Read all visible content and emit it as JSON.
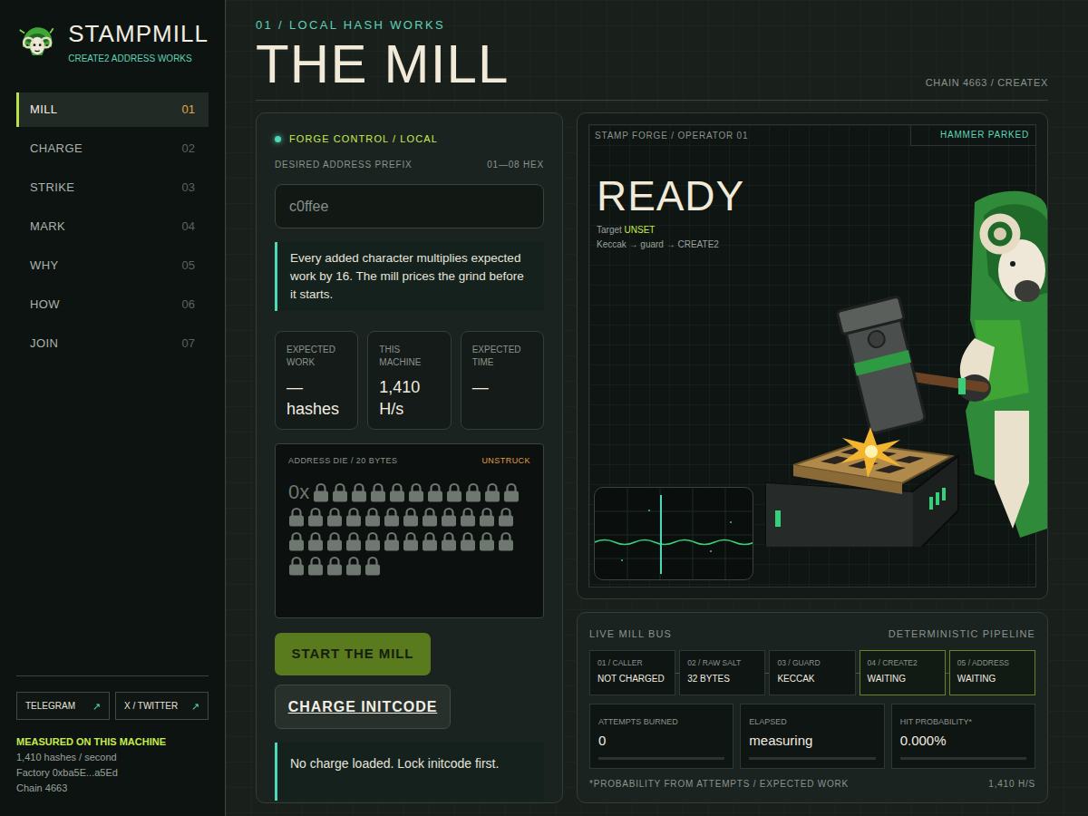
{
  "brand": {
    "name": "STAMPMILL",
    "tagline": "CREATE2 ADDRESS WORKS"
  },
  "nav": [
    {
      "label": "MILL",
      "number": "01",
      "selected": true
    },
    {
      "label": "CHARGE",
      "number": "02",
      "selected": false
    },
    {
      "label": "STRIKE",
      "number": "03",
      "selected": false
    },
    {
      "label": "MARK",
      "number": "04",
      "selected": false
    },
    {
      "label": "WHY",
      "number": "05",
      "selected": false
    },
    {
      "label": "HOW",
      "number": "06",
      "selected": false
    },
    {
      "label": "JOIN",
      "number": "07",
      "selected": false
    }
  ],
  "links": [
    {
      "label": "TELEGRAM",
      "icon": "↗"
    },
    {
      "label": "X / TWITTER",
      "icon": "↗"
    }
  ],
  "machine": {
    "title": "MEASURED ON THIS MACHINE",
    "lines": [
      "1,410 hashes / second",
      "Factory 0xba5E...a5Ed",
      "Chain 4663"
    ]
  },
  "header": {
    "eyebrow": "01 / LOCAL HASH WORKS",
    "title": "THE MILL",
    "chain": "CHAIN 4663 / CREATEX"
  },
  "control": {
    "title": "FORGE CONTROL / LOCAL",
    "prefix_label": "DESIRED ADDRESS PREFIX",
    "prefix_range": "01—08 HEX",
    "prefix_placeholder": "c0ffee",
    "note": "Every added character multiplies expected work by 16. The mill prices the grind before it starts.",
    "stats": [
      {
        "label": "EXPECTED WORK",
        "value": "—",
        "unit": "hashes"
      },
      {
        "label": "THIS MACHINE",
        "value": "1,410",
        "unit": "H/s"
      },
      {
        "label": "EXPECTED TIME",
        "value": "—"
      }
    ]
  },
  "die": {
    "label": "ADDRESS DIE / 20 BYTES",
    "status": "UNSTRUCK",
    "prefix": "0x",
    "slots": [
      {
        "locked": true
      },
      {
        "locked": true
      },
      {
        "locked": true
      },
      {
        "locked": true
      },
      {
        "locked": true
      },
      {
        "locked": true
      },
      {
        "locked": true
      },
      {
        "locked": true
      },
      {
        "locked": true
      },
      {
        "locked": true
      },
      {
        "locked": true
      },
      {
        "locked": true
      },
      {
        "locked": true
      },
      {
        "locked": true
      },
      {
        "locked": true
      },
      {
        "locked": true
      },
      {
        "locked": true
      },
      {
        "locked": true
      },
      {
        "locked": true
      },
      {
        "locked": true
      },
      {
        "locked": true
      },
      {
        "locked": true
      },
      {
        "locked": true
      },
      {
        "locked": true
      },
      {
        "locked": true
      },
      {
        "locked": true
      },
      {
        "locked": true
      },
      {
        "locked": true
      },
      {
        "locked": true
      },
      {
        "locked": true
      },
      {
        "locked": true
      },
      {
        "locked": true
      },
      {
        "locked": true
      },
      {
        "locked": true
      },
      {
        "locked": true
      },
      {
        "locked": true
      },
      {
        "locked": true
      },
      {
        "locked": true
      },
      {
        "locked": true
      },
      {
        "locked": true
      }
    ]
  },
  "buttons": {
    "start": "START THE MILL",
    "charge": "CHARGE INITCODE"
  },
  "message": "No charge loaded. Lock initcode first.",
  "forge": {
    "title": "STAMP FORGE / OPERATOR 01",
    "badge": "HAMMER PARKED",
    "status": "READY",
    "target_label": "Target",
    "target_value": "UNSET",
    "pipeline": "Keccak → guard → CREATE2"
  },
  "bus": {
    "title": "LIVE MILL BUS",
    "subtitle": "DETERMINISTIC PIPELINE",
    "steps": [
      {
        "label": "01 / CALLER",
        "value": "NOT CHARGED",
        "pending": false
      },
      {
        "label": "02 / RAW SALT",
        "value": "32 BYTES",
        "pending": false
      },
      {
        "label": "03 / GUARD",
        "value": "KECCAK",
        "pending": false
      },
      {
        "label": "04 / CREATE2",
        "value": "WAITING",
        "pending": true
      },
      {
        "label": "05 / ADDRESS",
        "value": "WAITING",
        "pending": true
      }
    ],
    "stats": [
      {
        "label": "ATTEMPTS BURNED",
        "value": "0",
        "level": 0
      },
      {
        "label": "ELAPSED",
        "value": "measuring",
        "level": 0
      },
      {
        "label": "HIT PROBABILITY*",
        "value": "0.000%",
        "level": 0
      }
    ],
    "footnote": "*PROBABILITY FROM ATTEMPTS / EXPECTED WORK",
    "rate": "1,410 H/S"
  }
}
